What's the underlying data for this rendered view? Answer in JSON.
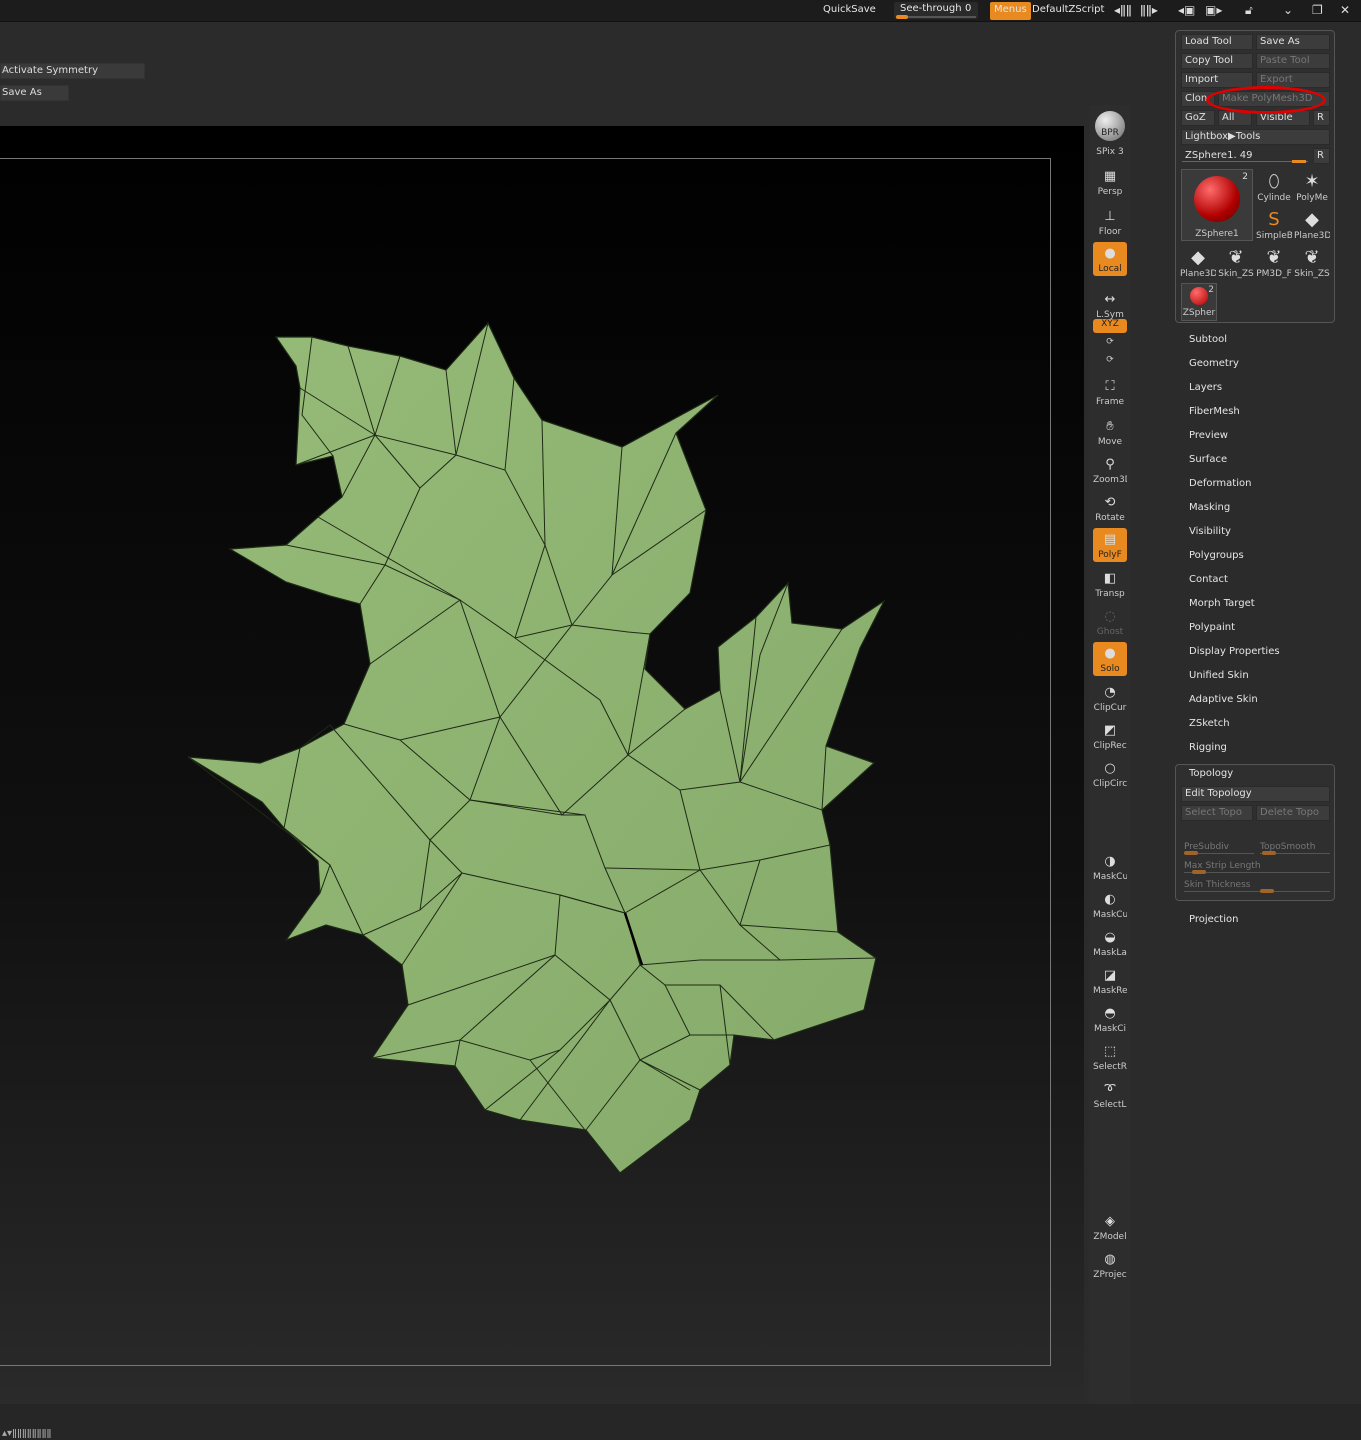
{
  "topbar": {
    "quicksave": "QuickSave",
    "seethrough_label": "See-through",
    "seethrough_value": "0",
    "menus": "Menus",
    "zscript": "DefaultZScript"
  },
  "options": {
    "activate_symmetry": "Activate Symmetry",
    "save_as": "Save As"
  },
  "shelf": {
    "bpr": "BPR",
    "spix_label": "SPix",
    "spix_value": "3",
    "persp": "Persp",
    "floor": "Floor",
    "local": "Local",
    "lsym": "L.Sym",
    "xyz": "XYZ",
    "frame": "Frame",
    "move": "Move",
    "zoom3d": "Zoom3D",
    "rotate": "Rotate",
    "polyf": "PolyF",
    "transp": "Transp",
    "ghost": "Ghost",
    "solo": "Solo",
    "clipcurve": "ClipCur",
    "cliprect": "ClipRec",
    "clipcircle": "ClipCirc",
    "maskcurve": "MaskCu",
    "maskcurve2": "MaskCu",
    "masklasso": "MaskLa",
    "maskrect": "MaskRe",
    "maskcircle": "MaskCi",
    "selectrect": "SelectR",
    "selectlasso": "SelectL",
    "zmodeler": "ZModel",
    "zproject": "ZProjec"
  },
  "tool": {
    "load_tool": "Load Tool",
    "save_as": "Save As",
    "copy_tool": "Copy Tool",
    "paste_tool": "Paste Tool",
    "import": "Import",
    "export": "Export",
    "clone": "Clon",
    "make_polymesh": "Make PolyMesh3D",
    "goz": "GoZ",
    "all": "All",
    "visible": "Visible",
    "r": "R",
    "lightbox": "Lightbox▶Tools",
    "current_tool": "ZSphere1. 49",
    "current_r": "R",
    "main_thumb_label": "ZSphere1",
    "main_thumb_count": "2",
    "thumbs": [
      "Cylinde",
      "PolyMe",
      "SimpleB",
      "Plane3D",
      "Plane3D",
      "Skin_ZS",
      "PM3D_F",
      "Skin_ZS",
      "ZSpher"
    ],
    "last_thumb_count": "2"
  },
  "menu_items": [
    "Subtool",
    "Geometry",
    "Layers",
    "FiberMesh",
    "Preview",
    "Surface",
    "Deformation",
    "Masking",
    "Visibility",
    "Polygroups",
    "Contact",
    "Morph Target",
    "Polypaint",
    "Display Properties",
    "Unified Skin",
    "Adaptive Skin",
    "ZSketch",
    "Rigging"
  ],
  "topology": {
    "title": "Topology",
    "edit_topology": "Edit Topology",
    "select_topo": "Select Topo",
    "delete_topo": "Delete Topo",
    "presubdiv": "PreSubdiv",
    "toposmooth": "TopoSmooth",
    "max_strip_length": "Max Strip Length",
    "skin_thickness": "Skin Thickness"
  },
  "projection": "Projection",
  "colors": {
    "accent": "#e98a20",
    "mesh_fill": "#8fb272",
    "mesh_edge": "#1e2a16",
    "highlight": "#e00000"
  }
}
